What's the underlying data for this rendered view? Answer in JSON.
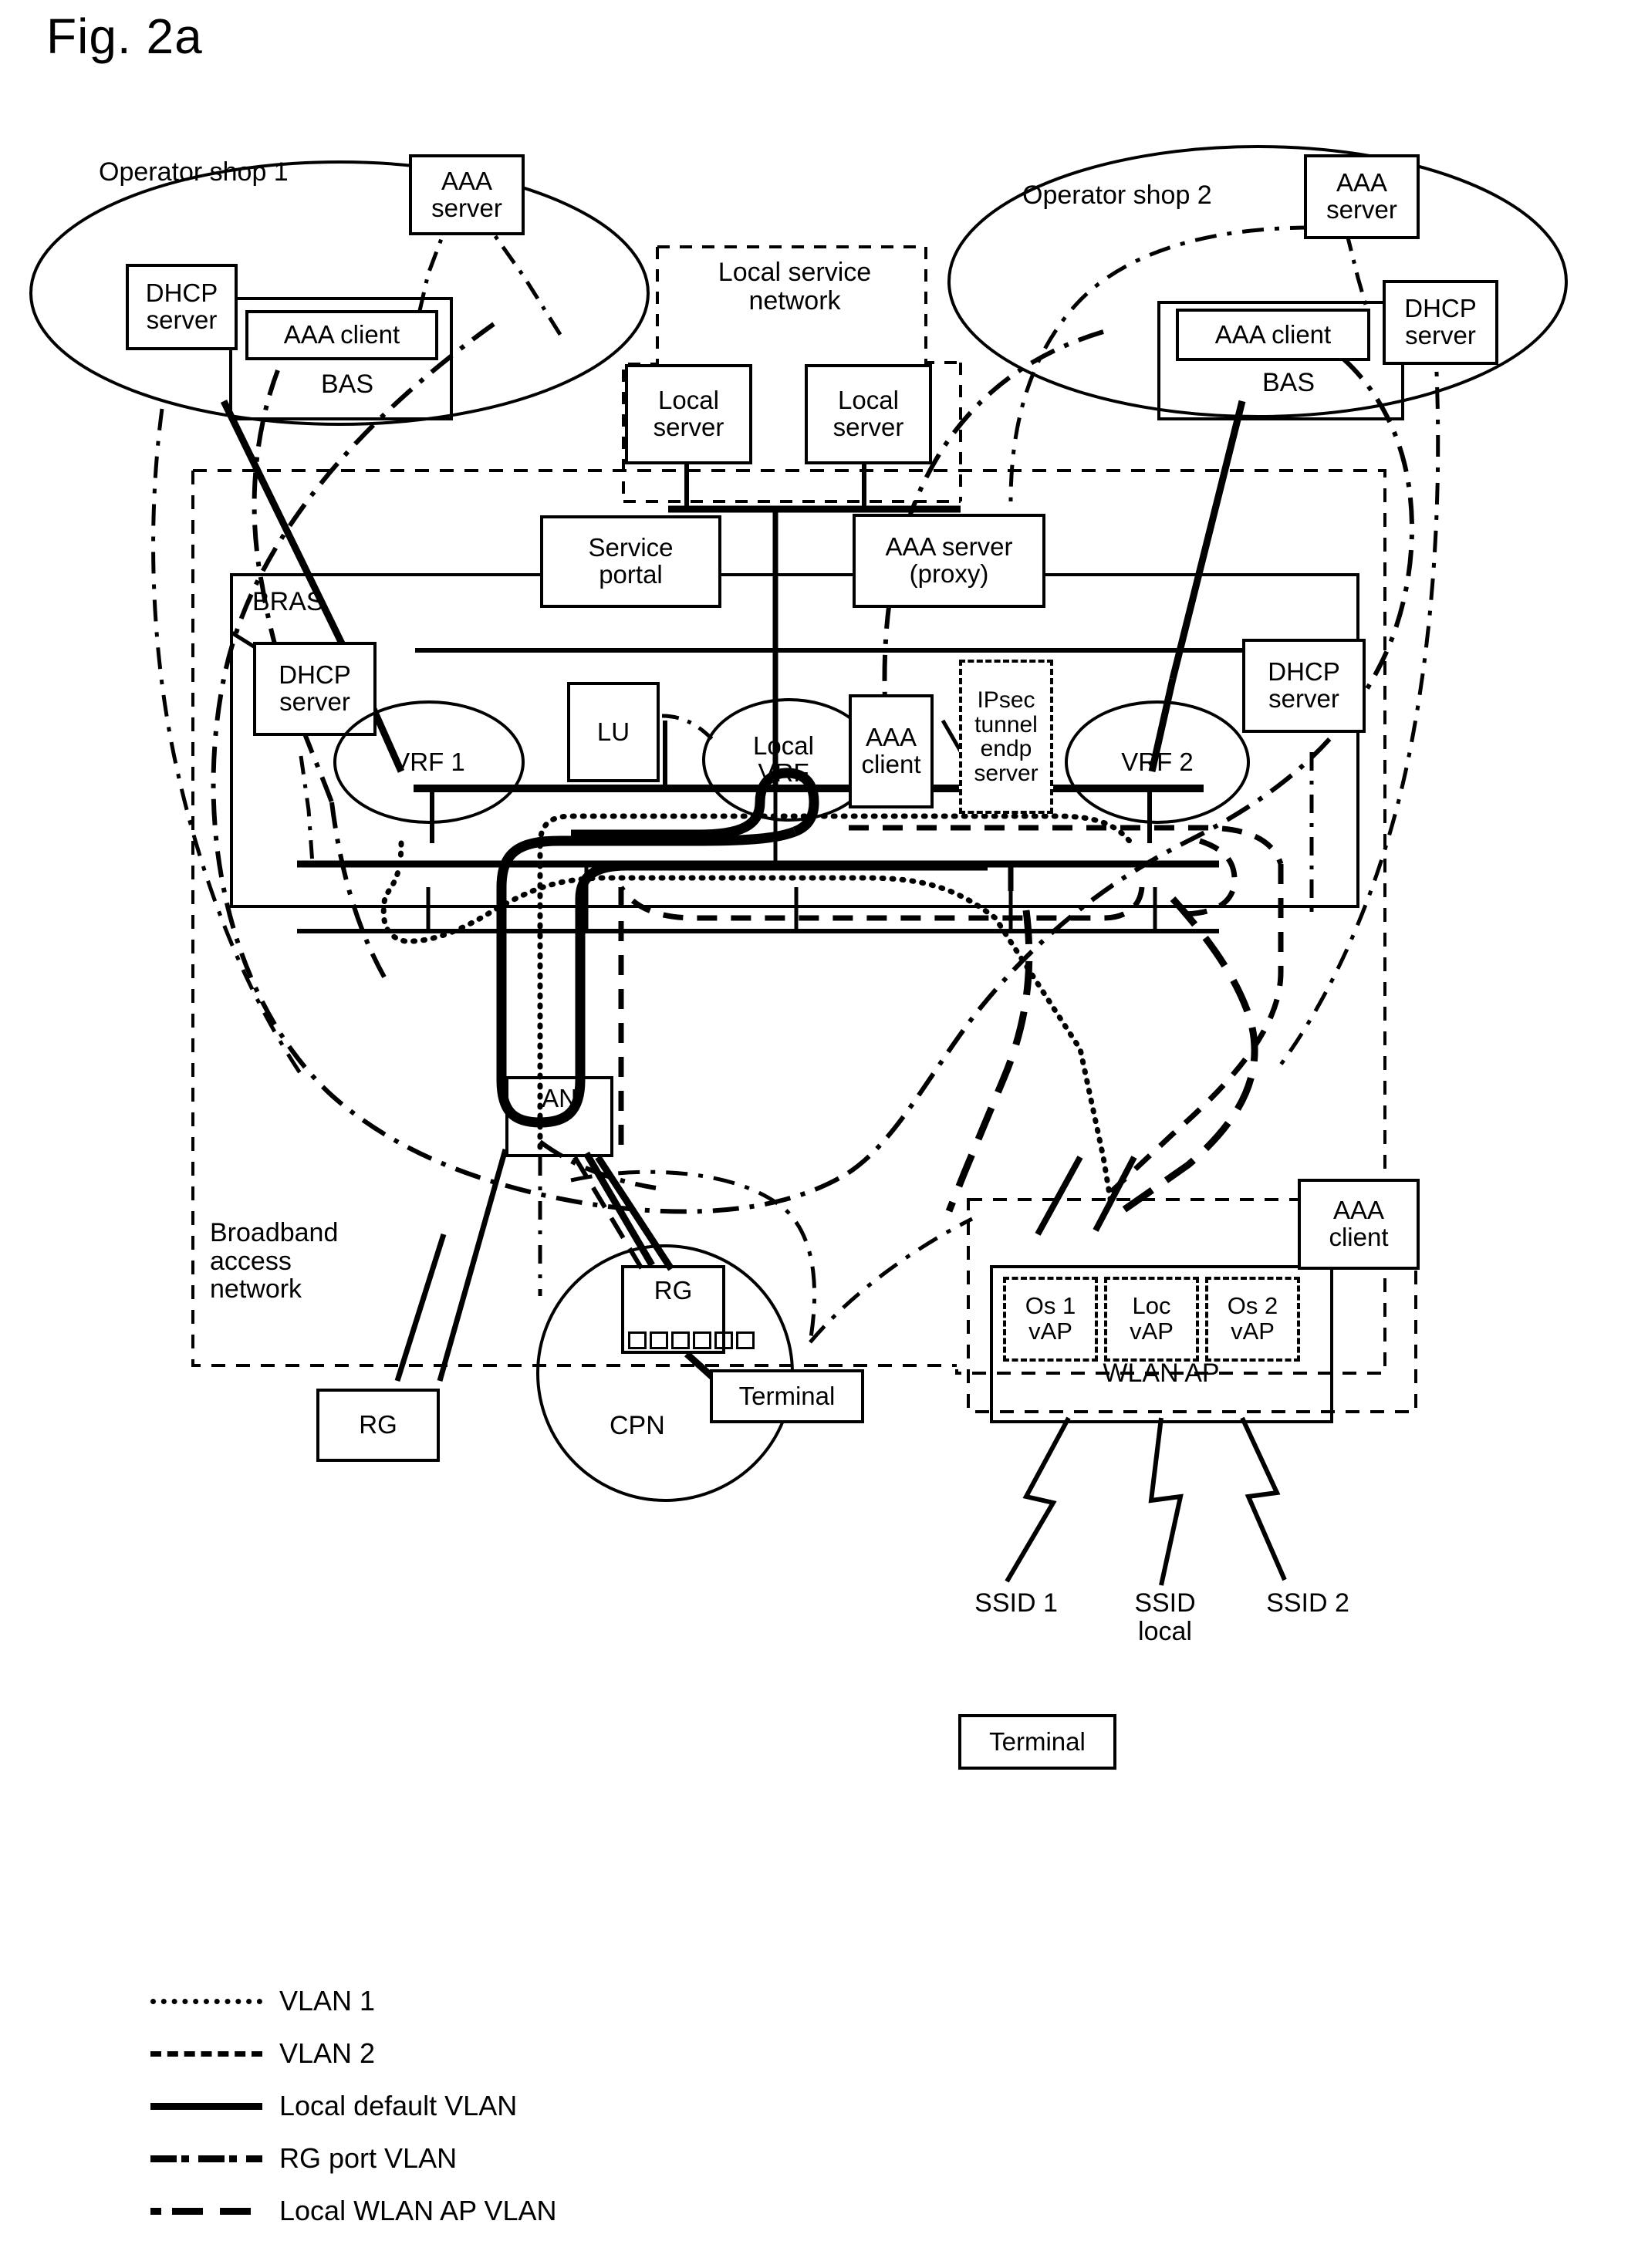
{
  "figure": {
    "title": "Fig. 2a"
  },
  "regions": {
    "operator_shop_1": "Operator shop 1",
    "operator_shop_2": "Operator shop 2",
    "local_service_network": "Local service\nnetwork",
    "broadband_access_network": "Broadband\naccess\nnetwork",
    "bras": "BRAS",
    "cpn": "CPN",
    "wlan_ap": "WLAN AP"
  },
  "nodes": {
    "shop1_aaa_server": "AAA\nserver",
    "shop1_dhcp_server": "DHCP\nserver",
    "shop1_aaa_client": "AAA client",
    "shop1_bas": "BAS",
    "shop2_aaa_server": "AAA\nserver",
    "shop2_dhcp_server": "DHCP\nserver",
    "shop2_aaa_client": "AAA client",
    "shop2_bas": "BAS",
    "local_server_1": "Local\nserver",
    "local_server_2": "Local\nserver",
    "service_portal": "Service\nportal",
    "aaa_server_proxy": "AAA server\n(proxy)",
    "bras_dhcp_server": "DHCP\nserver",
    "vrf1": "VRF 1",
    "lu": "LU",
    "local_vrf": "Local\nVRF",
    "bras_aaa_client": "AAA\nclient",
    "ipsec_tunnel_endp_server": "IPsec\ntunnel\nendp\nserver",
    "vrf2": "VRF 2",
    "vrf2_dhcp_server": "DHCP\nserver",
    "an": "AN",
    "rg_cpn": "RG",
    "rg_standalone": "RG",
    "terminal_cpn": "Terminal",
    "terminal_legend": "Terminal",
    "vap_os1": "Os 1\nvAP",
    "vap_loc": "Loc\nvAP",
    "vap_os2": "Os 2\nvAP",
    "wlan_aaa_client": "AAA\nclient"
  },
  "ssid": {
    "ssid1": "SSID 1",
    "ssid_local": "SSID\nlocal",
    "ssid2": "SSID 2"
  },
  "legend": {
    "items": [
      {
        "key": "dotted",
        "label": "VLAN 1"
      },
      {
        "key": "dashed",
        "label": "VLAN 2"
      },
      {
        "key": "solid-thick",
        "label": "Local default VLAN"
      },
      {
        "key": "dash-dot",
        "label": "RG port VLAN"
      },
      {
        "key": "long-dash",
        "label": "Local WLAN AP VLAN"
      }
    ]
  },
  "colors": {
    "ink": "#000000",
    "paper": "#ffffff"
  }
}
